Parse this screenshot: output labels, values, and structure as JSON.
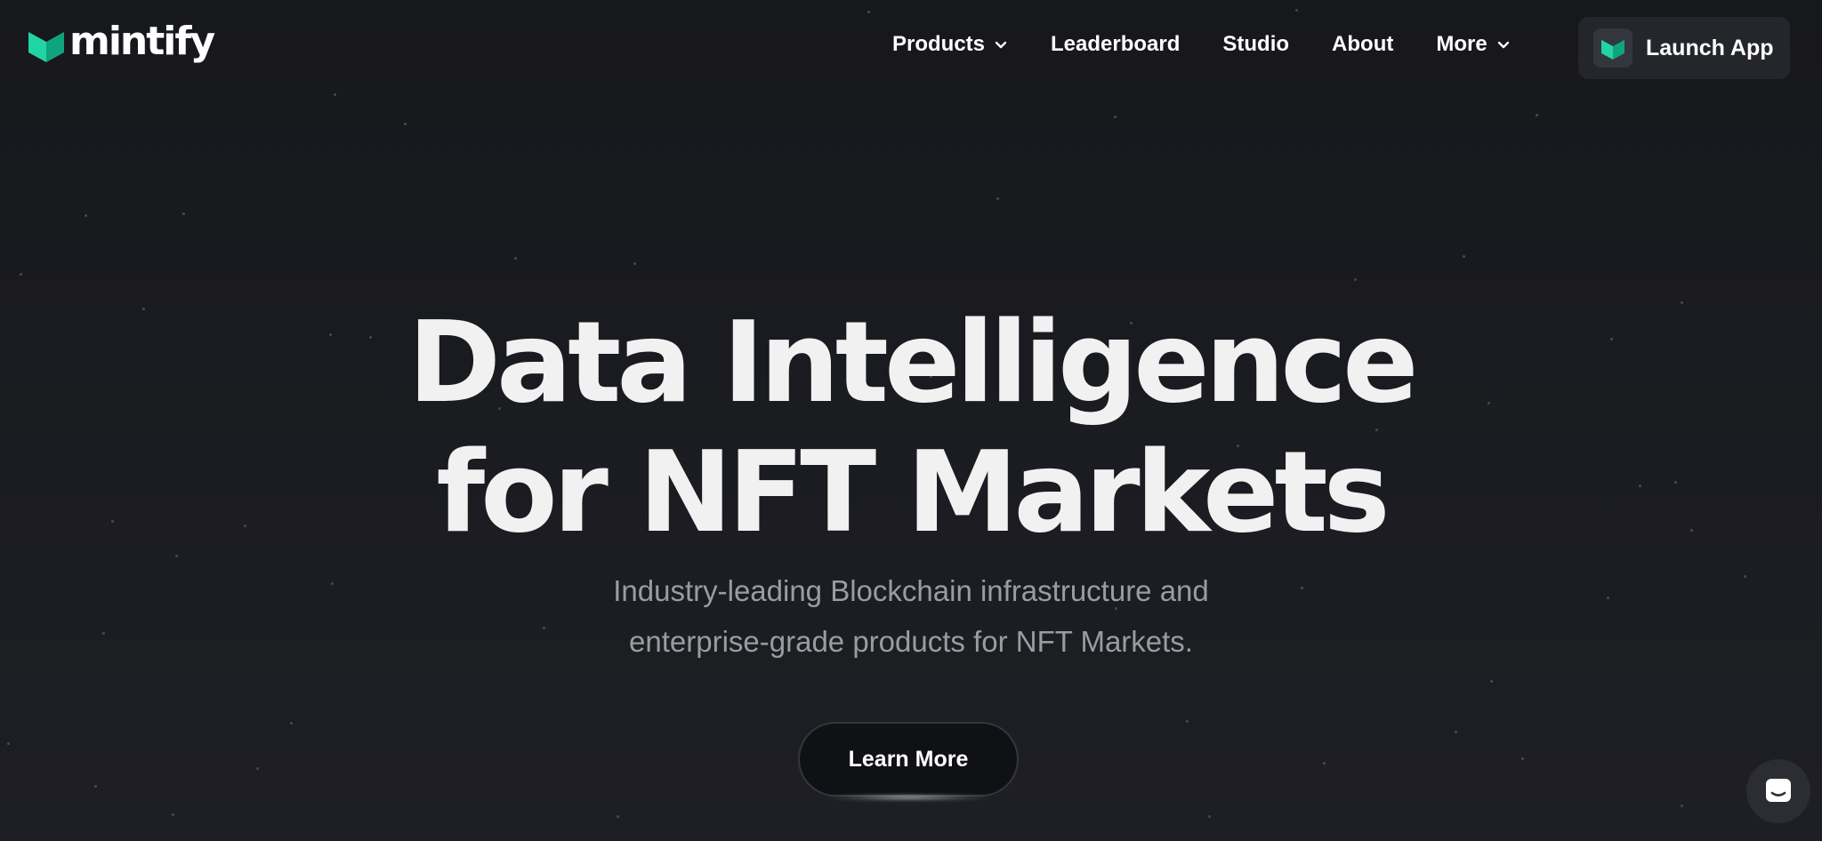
{
  "brand": {
    "name": "mintify",
    "accent": "#22d3a6",
    "accent_dark": "#0fa37f"
  },
  "nav": {
    "items": [
      {
        "label": "Products",
        "dropdown": true
      },
      {
        "label": "Leaderboard",
        "dropdown": false
      },
      {
        "label": "Studio",
        "dropdown": false
      },
      {
        "label": "About",
        "dropdown": false
      },
      {
        "label": "More",
        "dropdown": true
      }
    ],
    "cta_label": "Launch App"
  },
  "hero": {
    "title_line1": "Data Intelligence",
    "title_line2": "for NFT Markets",
    "subtitle_line1": "Industry-leading Blockchain infrastructure and",
    "subtitle_line2": "enterprise-grade products for NFT Markets.",
    "button_label": "Learn More"
  },
  "icons": {
    "nav_dropdown": "chevron-down-icon",
    "chat": "chat-icon",
    "logo": "mintify-logo-icon"
  },
  "colors": {
    "background": "#17181c",
    "text": "#f1f1f1",
    "subtitle": "#9b9ca1",
    "button_surface": "#24262b"
  }
}
